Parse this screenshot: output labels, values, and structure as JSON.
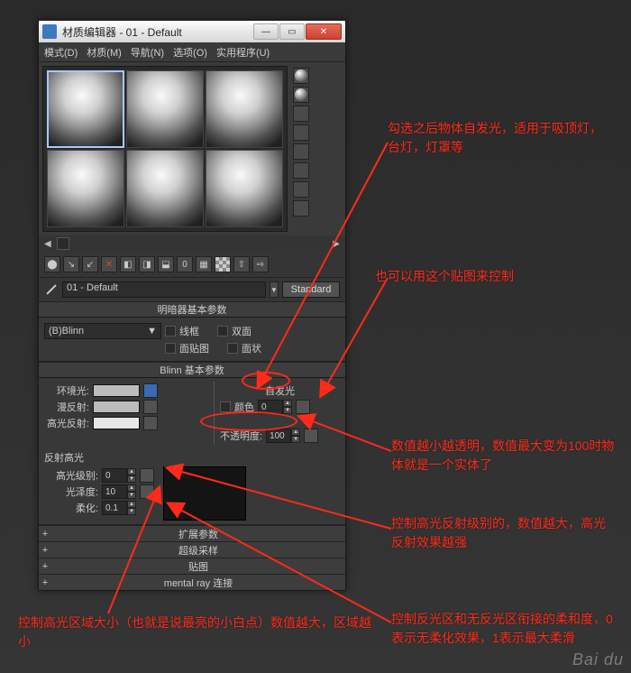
{
  "window": {
    "title": "材质编辑器 - 01 - Default"
  },
  "menu": {
    "mode": "模式(D)",
    "material": "材质(M)",
    "nav": "导航(N)",
    "options": "选项(O)",
    "util": "实用程序(U)"
  },
  "name_field": {
    "value": "01 - Default",
    "type_label": "Standard"
  },
  "shader_basic": {
    "title": "明暗器基本参数",
    "select": "(B)Blinn",
    "wireframe": "线框",
    "two_sided": "双面",
    "face_map": "面贴图",
    "faceted": "面状"
  },
  "blinn_basic": {
    "title": "Blinn 基本参数",
    "self_illum": "自发光",
    "color": "颜色",
    "color_val": "0",
    "ambient": "环境光:",
    "diffuse": "漫反射:",
    "specular": "高光反射:",
    "opacity": "不透明度:",
    "opacity_val": "100",
    "highlights": "反射高光",
    "level": "高光级别:",
    "level_val": "0",
    "gloss": "光泽度:",
    "gloss_val": "10",
    "soften": "柔化:",
    "soften_val": "0.1"
  },
  "rollups": {
    "ext": "扩展参数",
    "super": "超级采样",
    "maps": "贴图",
    "mr": "mental ray 连接"
  },
  "annot": {
    "a1": "勾选之后物体自发光，适用于吸顶灯，台灯，灯罩等",
    "a2": "也可以用这个贴图来控制",
    "a3": "数值越小越透明，数值最大变为100时物体就是一个实体了",
    "a4": "控制高光反射级别的，数值越大，高光反射效果越强",
    "a5": "控制反光区和无反光区衔接的柔和度，0表示无柔化效果，1表示最大柔滑",
    "a6": "控制高光区域大小（也就是说最亮的小白点）数值越大，区域越小"
  },
  "watermark": "Bai du"
}
